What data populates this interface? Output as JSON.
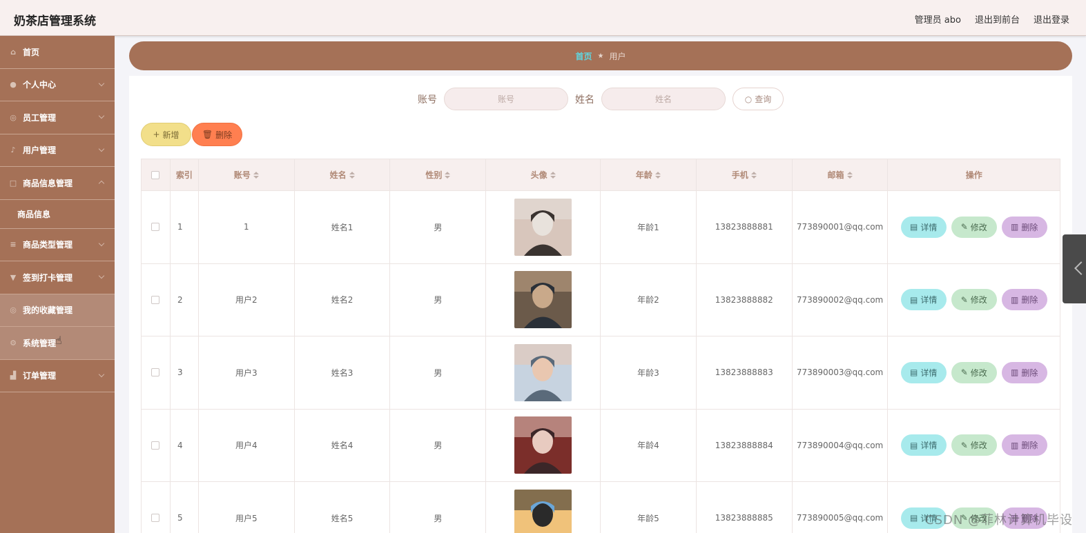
{
  "header": {
    "app_title": "奶茶店管理系统",
    "admin_label": "管理员 abo",
    "exit_front_label": "退出到前台",
    "logout_label": "退出登录"
  },
  "sidebar": {
    "items": [
      {
        "label": "首页",
        "icon": "home-icon"
      },
      {
        "label": "个人中心",
        "icon": "user-icon"
      },
      {
        "label": "员工管理",
        "icon": "globe-icon"
      },
      {
        "label": "用户管理",
        "icon": "mic-icon"
      },
      {
        "label": "商品信息管理",
        "icon": "square-icon"
      },
      {
        "label": "商品信息",
        "icon": ""
      },
      {
        "label": "商品类型管理",
        "icon": "list-icon"
      },
      {
        "label": "签到打卡管理",
        "icon": "cup-icon"
      },
      {
        "label": "我的收藏管理",
        "icon": "globe-icon"
      },
      {
        "label": "系统管理",
        "icon": "gear-icon"
      },
      {
        "label": "订单管理",
        "icon": "chart-icon"
      }
    ]
  },
  "breadcrumb": {
    "home": "首页",
    "current": "用户"
  },
  "search": {
    "account_label": "账号",
    "account_placeholder": "账号",
    "name_label": "姓名",
    "name_placeholder": "姓名",
    "query_label": "查询"
  },
  "toolbar": {
    "add_label": "新增",
    "delete_label": "删除"
  },
  "table": {
    "headers": [
      "索引",
      "账号",
      "姓名",
      "性别",
      "头像",
      "年龄",
      "手机",
      "邮箱",
      "操作"
    ],
    "rows": [
      {
        "index": "1",
        "account": "1",
        "name": "姓名1",
        "gender": "男",
        "age": "年龄1",
        "phone": "13823888881",
        "email": "773890001@qq.com"
      },
      {
        "index": "2",
        "account": "用户2",
        "name": "姓名2",
        "gender": "男",
        "age": "年龄2",
        "phone": "13823888882",
        "email": "773890002@qq.com"
      },
      {
        "index": "3",
        "account": "用户3",
        "name": "姓名3",
        "gender": "男",
        "age": "年龄3",
        "phone": "13823888883",
        "email": "773890003@qq.com"
      },
      {
        "index": "4",
        "account": "用户4",
        "name": "姓名4",
        "gender": "男",
        "age": "年龄4",
        "phone": "13823888884",
        "email": "773890004@qq.com"
      },
      {
        "index": "5",
        "account": "用户5",
        "name": "姓名5",
        "gender": "男",
        "age": "年龄5",
        "phone": "13823888885",
        "email": "773890005@qq.com"
      }
    ],
    "op_detail": "详情",
    "op_edit": "修改",
    "op_delete": "删除"
  },
  "watermark": "CSDN @菲林计算机毕设",
  "colors": {
    "sidebar_bg": "#a57157",
    "header_bg": "#f8f0ef",
    "breadcrumb_home": "#5fd6e0",
    "add_button": "#f2df8a",
    "delete_button": "#ff7f50",
    "detail_button": "#a7eaec",
    "edit_button": "#c6e8cc",
    "row_delete_button": "#d7b7e3"
  }
}
